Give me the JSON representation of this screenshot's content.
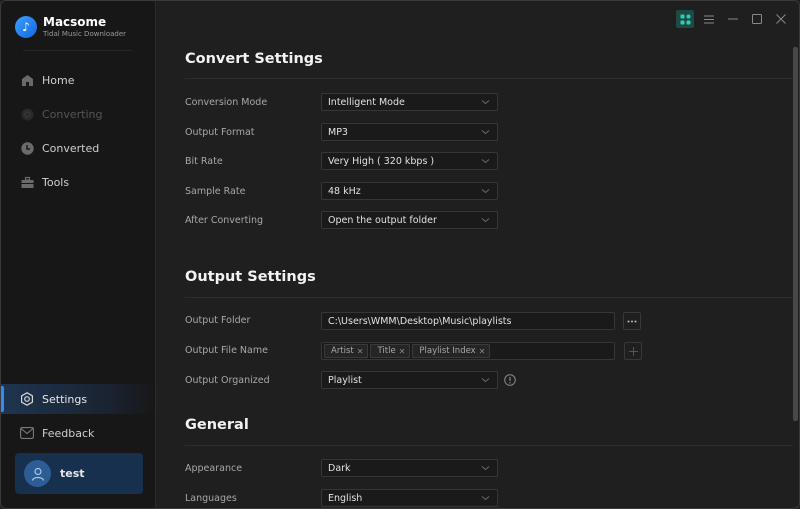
{
  "app": {
    "name": "Macsome",
    "subtitle": "Tidal Music Downloader"
  },
  "sidebar": {
    "items": [
      {
        "label": "Home",
        "icon": "home-icon",
        "state": "normal"
      },
      {
        "label": "Converting",
        "icon": "converting-icon",
        "state": "disabled"
      },
      {
        "label": "Converted",
        "icon": "clock-icon",
        "state": "normal"
      },
      {
        "label": "Tools",
        "icon": "toolbox-icon",
        "state": "normal"
      },
      {
        "label": "Settings",
        "icon": "settings-icon",
        "state": "active"
      },
      {
        "label": "Feedback",
        "icon": "mail-icon",
        "state": "normal"
      }
    ],
    "user": {
      "name": "test"
    }
  },
  "window_controls": [
    "apps-icon",
    "menu-icon",
    "minimize-icon",
    "maximize-icon",
    "close-icon"
  ],
  "colors": {
    "accent": "#2f8cff",
    "apps_button": "#1c4a44",
    "apps_icon": "#2ad1b0",
    "user_card": "#16304e"
  },
  "convert_settings": {
    "title": "Convert Settings",
    "rows": [
      {
        "label": "Conversion Mode",
        "value": "Intelligent Mode"
      },
      {
        "label": "Output Format",
        "value": "MP3"
      },
      {
        "label": "Bit Rate",
        "value": "Very High ( 320 kbps )"
      },
      {
        "label": "Sample Rate",
        "value": "48 kHz"
      },
      {
        "label": "After Converting",
        "value": "Open the output folder"
      }
    ]
  },
  "output_settings": {
    "title": "Output Settings",
    "folder": {
      "label": "Output Folder",
      "value": "C:\\Users\\WMM\\Desktop\\Music\\playlists",
      "browse_label": "..."
    },
    "file_name": {
      "label": "Output File Name",
      "tags": [
        "Artist",
        "Title",
        "Playlist Index"
      ],
      "add_label": "+"
    },
    "organized": {
      "label": "Output Organized",
      "value": "Playlist"
    }
  },
  "general": {
    "title": "General",
    "rows": [
      {
        "label": "Appearance",
        "value": "Dark"
      },
      {
        "label": "Languages",
        "value": "English"
      }
    ]
  },
  "scrollbar": {
    "position_fraction": 0.0,
    "visible_fraction": 0.81
  }
}
